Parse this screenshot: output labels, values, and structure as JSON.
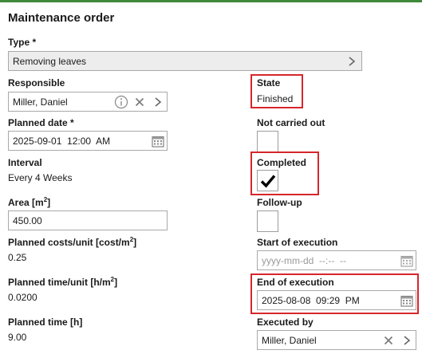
{
  "form": {
    "title": "Maintenance order",
    "type": {
      "label": "Type *",
      "value": "Removing leaves"
    },
    "responsible": {
      "label": "Responsible",
      "value": "Miller, Daniel"
    },
    "state": {
      "label": "State",
      "value": "Finished"
    },
    "planned_date": {
      "label": "Planned date *",
      "value": "2025-09-01  12:00  AM"
    },
    "not_carried_out": {
      "label": "Not carried out",
      "checked": false
    },
    "interval": {
      "label": "Interval",
      "value": "Every 4 Weeks"
    },
    "completed": {
      "label": "Completed",
      "checked": true
    },
    "area": {
      "label_main": "Area [m",
      "label_sup": "2",
      "label_end": "]",
      "value": "450.00"
    },
    "follow_up": {
      "label": "Follow-up",
      "checked": false
    },
    "planned_costs_unit": {
      "label_main": "Planned costs/unit [cost/m",
      "label_sup": "2",
      "label_end": "]",
      "value": "0.25"
    },
    "start_of_execution": {
      "label": "Start of execution",
      "placeholder": "yyyy-mm-dd  --:--  --"
    },
    "planned_time_unit": {
      "label_main": "Planned time/unit [h/m",
      "label_sup": "2",
      "label_end": "]",
      "value": "0.0200"
    },
    "end_of_execution": {
      "label": "End of execution",
      "value": "2025-08-08  09:29  PM"
    },
    "planned_time": {
      "label": "Planned time [h]",
      "value": "9.00"
    },
    "executed_by": {
      "label": "Executed by",
      "value": "Miller, Daniel"
    }
  },
  "icons": {
    "chevron": "chevron-right-icon",
    "info": "info-icon",
    "clear": "close-icon",
    "calendar": "calendar-icon",
    "check": "checkmark-icon"
  },
  "colors": {
    "highlight": "#d6262b",
    "top_bar": "#3f8a3a",
    "field_border": "#a9a9a9",
    "disabled_field": "#ededed"
  }
}
